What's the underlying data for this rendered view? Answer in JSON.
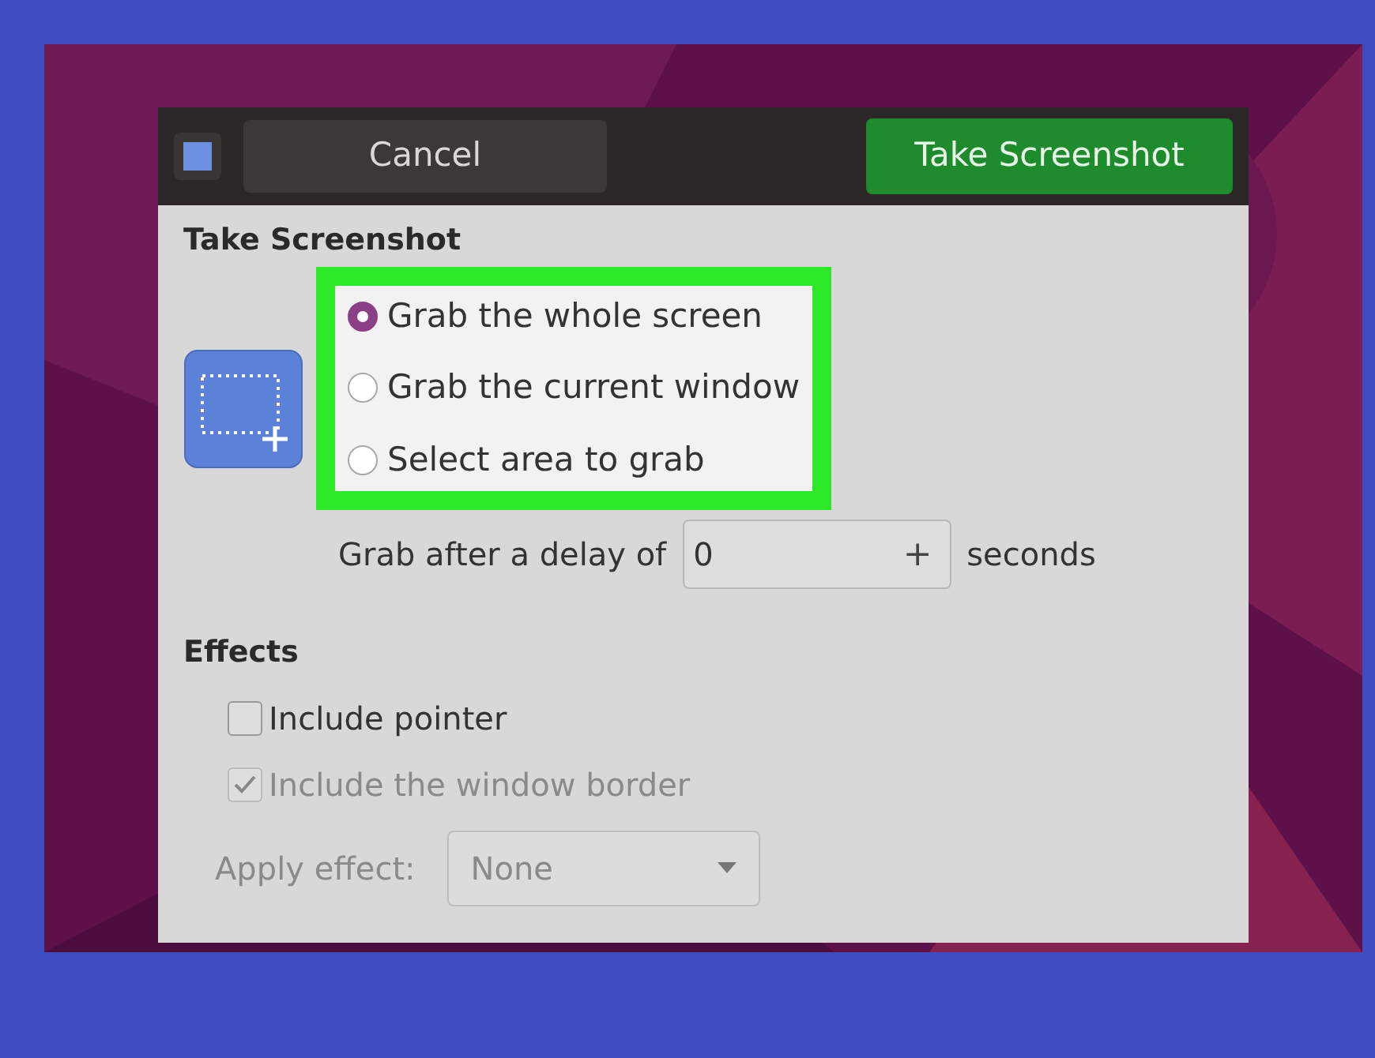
{
  "header": {
    "cancel_label": "Cancel",
    "action_label": "Take Screenshot"
  },
  "title": "Take Screenshot",
  "grab_modes": [
    {
      "label": "Grab the whole screen",
      "selected": true
    },
    {
      "label": "Grab the current window",
      "selected": false
    },
    {
      "label": "Select area to grab",
      "selected": false
    }
  ],
  "delay": {
    "label": "Grab after a delay of",
    "value": "0",
    "plus": "+",
    "unit": "seconds"
  },
  "effects": {
    "title": "Effects",
    "options": [
      {
        "label": "Include pointer",
        "checked": false,
        "disabled": false
      },
      {
        "label": "Include the window border",
        "checked": true,
        "disabled": true
      }
    ],
    "apply_effect": {
      "label": "Apply effect:",
      "value": "None",
      "disabled": true
    }
  }
}
